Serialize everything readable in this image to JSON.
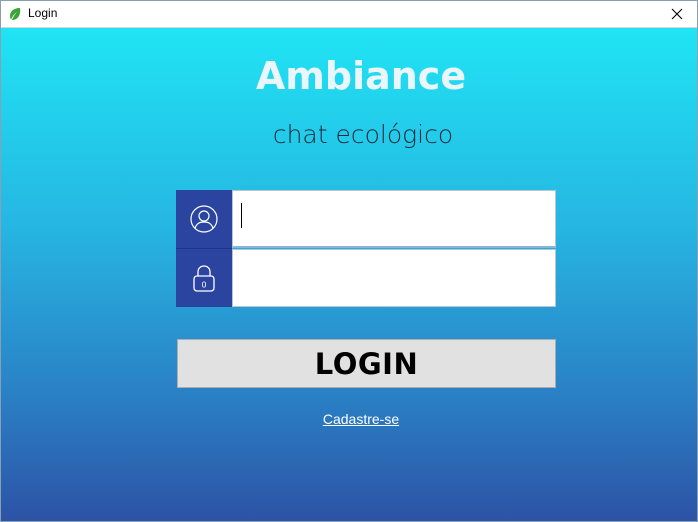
{
  "window": {
    "title": "Login",
    "icons": {
      "app": "leaf-icon",
      "close": "close-icon"
    }
  },
  "header": {
    "app_name": "Ambiance",
    "subtitle": "chat ecológico"
  },
  "form": {
    "username": {
      "value": "",
      "placeholder": "",
      "icon": "user-icon"
    },
    "password": {
      "value": "",
      "placeholder": "",
      "icon": "lock-icon",
      "icon_glyph": "0"
    },
    "login_label": "LOGIN",
    "register_label": "Cadastre-se"
  },
  "colors": {
    "gradient_top": "#20e4f4",
    "gradient_bottom": "#2d52a6",
    "icon_panel": "#2a44a0",
    "button_bg": "#e1e1e1",
    "title_text": "#eaf6fb"
  }
}
